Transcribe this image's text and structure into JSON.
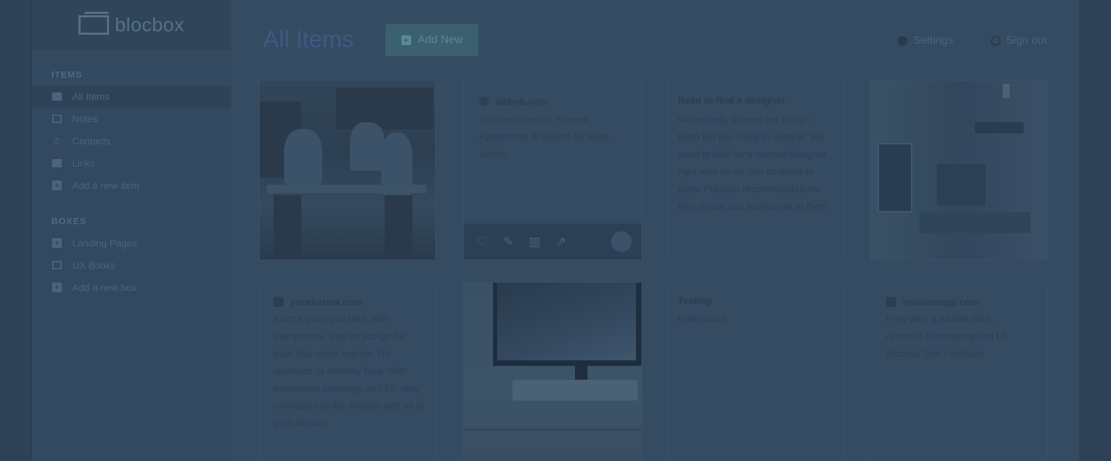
{
  "brand": {
    "name": "blocbox"
  },
  "page": {
    "title": "All Items"
  },
  "header": {
    "add_new_label": "Add New",
    "settings_label": "Settings",
    "signout_label": "Sign out"
  },
  "sidebar": {
    "items_heading": "ITEMS",
    "items": [
      {
        "label": "All Items",
        "icon": "grid-icon"
      },
      {
        "label": "Notes",
        "icon": "note-icon"
      },
      {
        "label": "Contacts",
        "icon": "phone-icon"
      },
      {
        "label": "Links",
        "icon": "briefcase-icon"
      },
      {
        "label": "Add a new item",
        "icon": "plus-icon"
      }
    ],
    "boxes_heading": "BOXES",
    "boxes": [
      {
        "label": "Landing Pages",
        "icon": "plus-icon"
      },
      {
        "label": "UX Books",
        "icon": "box-icon"
      },
      {
        "label": "Add a new box",
        "icon": "plus-icon"
      }
    ]
  },
  "cards": {
    "airbnb": {
      "site": "airbnb.com",
      "text": "Vacation Rentals, Homes, Apartments & Rooms for Rent - Airbnb"
    },
    "designer": {
      "title": "Need to find a designer",
      "text": "We recently formed our design team but are ready to expand. We need to look for a second designer right now so we can continue to grow. Put your recommendations here so we can analyse all of them."
    },
    "karma": {
      "site": "yourkarma.com",
      "text": "Karma gives you take WiFi everywhere. Pay as you go for data that never expires. No contracts or monthly fees. With nationwide coverage on LTE, stay connected to the internet with all of your devices."
    },
    "testing": {
      "title": "Testing",
      "text": "Hello world"
    },
    "invision": {
      "site": "invisionapp.com",
      "text": "Free Web & Mobile (iOS, Android) Prototyping and UI Mockup Tool - InVision"
    }
  },
  "colors": {
    "overlay_background": "#354b62",
    "sidebar_background": "#33495f",
    "button_accent": "#3b6170"
  }
}
